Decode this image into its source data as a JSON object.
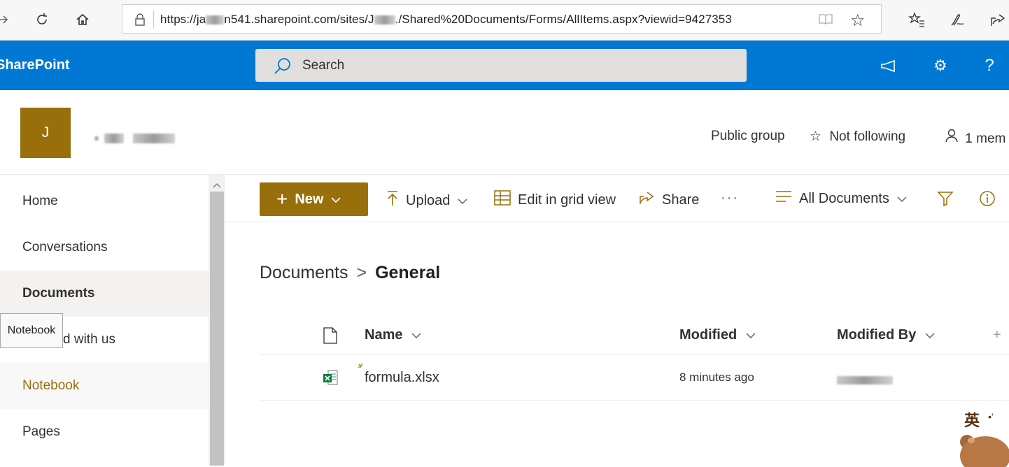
{
  "browser": {
    "url_prefix": "https://ja",
    "url_middle": "n541.sharepoint.com/sites/J",
    "url_suffix": "./Shared%20Documents/Forms/AllItems.aspx?viewid=9427353"
  },
  "suite": {
    "brand": "SharePoint",
    "search_placeholder": "Search"
  },
  "site": {
    "logo_letter": "J",
    "group_type": "Public group",
    "follow_label": "Not following",
    "members_label": "1 mem",
    "logo_color": "#986f0b"
  },
  "leftnav": {
    "items": [
      {
        "label": "Home"
      },
      {
        "label": "Conversations"
      },
      {
        "label": "Documents"
      },
      {
        "label": "d with us"
      },
      {
        "label": "Notebook"
      },
      {
        "label": "Pages"
      }
    ],
    "tooltip": "Notebook"
  },
  "commandbar": {
    "new_label": "New",
    "upload_label": "Upload",
    "grid_label": "Edit in grid view",
    "share_label": "Share",
    "more_label": "···",
    "view_label": "All Documents"
  },
  "breadcrumb": {
    "parent": "Documents",
    "separator": ">",
    "current": "General"
  },
  "list": {
    "columns": {
      "name": "Name",
      "modified": "Modified",
      "modified_by": "Modified By"
    },
    "add_column": "+",
    "rows": [
      {
        "name": "formula.xlsx",
        "modified": "8 minutes ago"
      }
    ]
  },
  "overlay": {
    "glyph": "英"
  },
  "colors": {
    "suite": "#0078d4",
    "accent": "#986f0b"
  }
}
